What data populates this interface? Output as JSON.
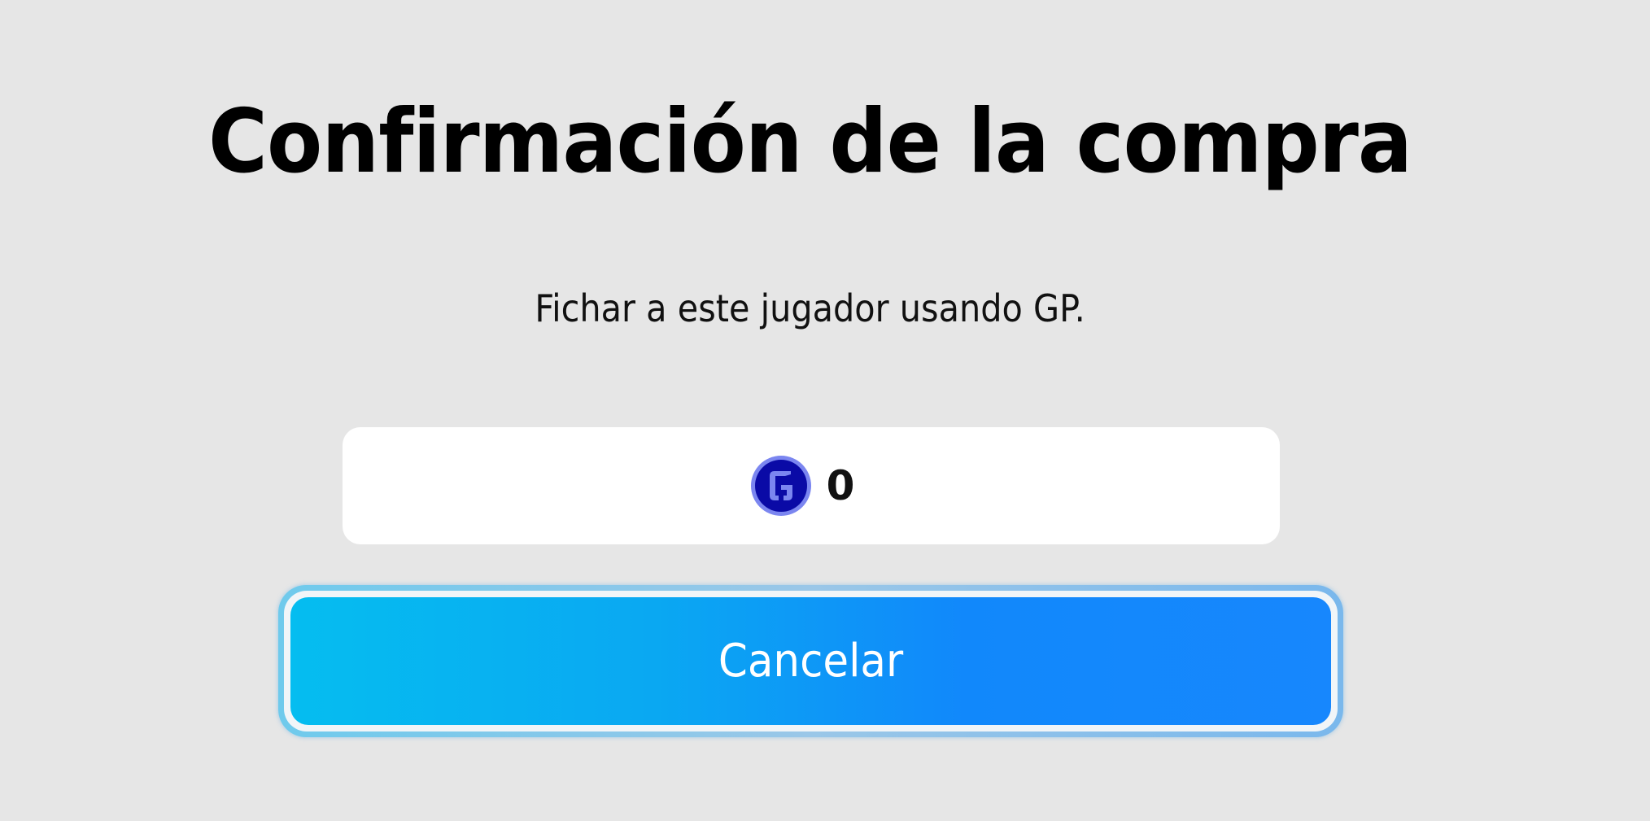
{
  "dialog": {
    "title": "Confirmación de la compra",
    "message": "Fichar a este jugador usando GP.",
    "price": {
      "currency_icon": "gp-coin-icon",
      "value": "0"
    },
    "cancel_label": "Cancelar"
  },
  "colors": {
    "background": "#e6e6e6",
    "price_box": "#ffffff",
    "button_gradient_start": "#05bdf0",
    "button_gradient_end": "#1787fd",
    "coin_outer": "#7b86f0",
    "coin_inner": "#0a0aa6",
    "coin_glyph": "#7b86f0"
  }
}
